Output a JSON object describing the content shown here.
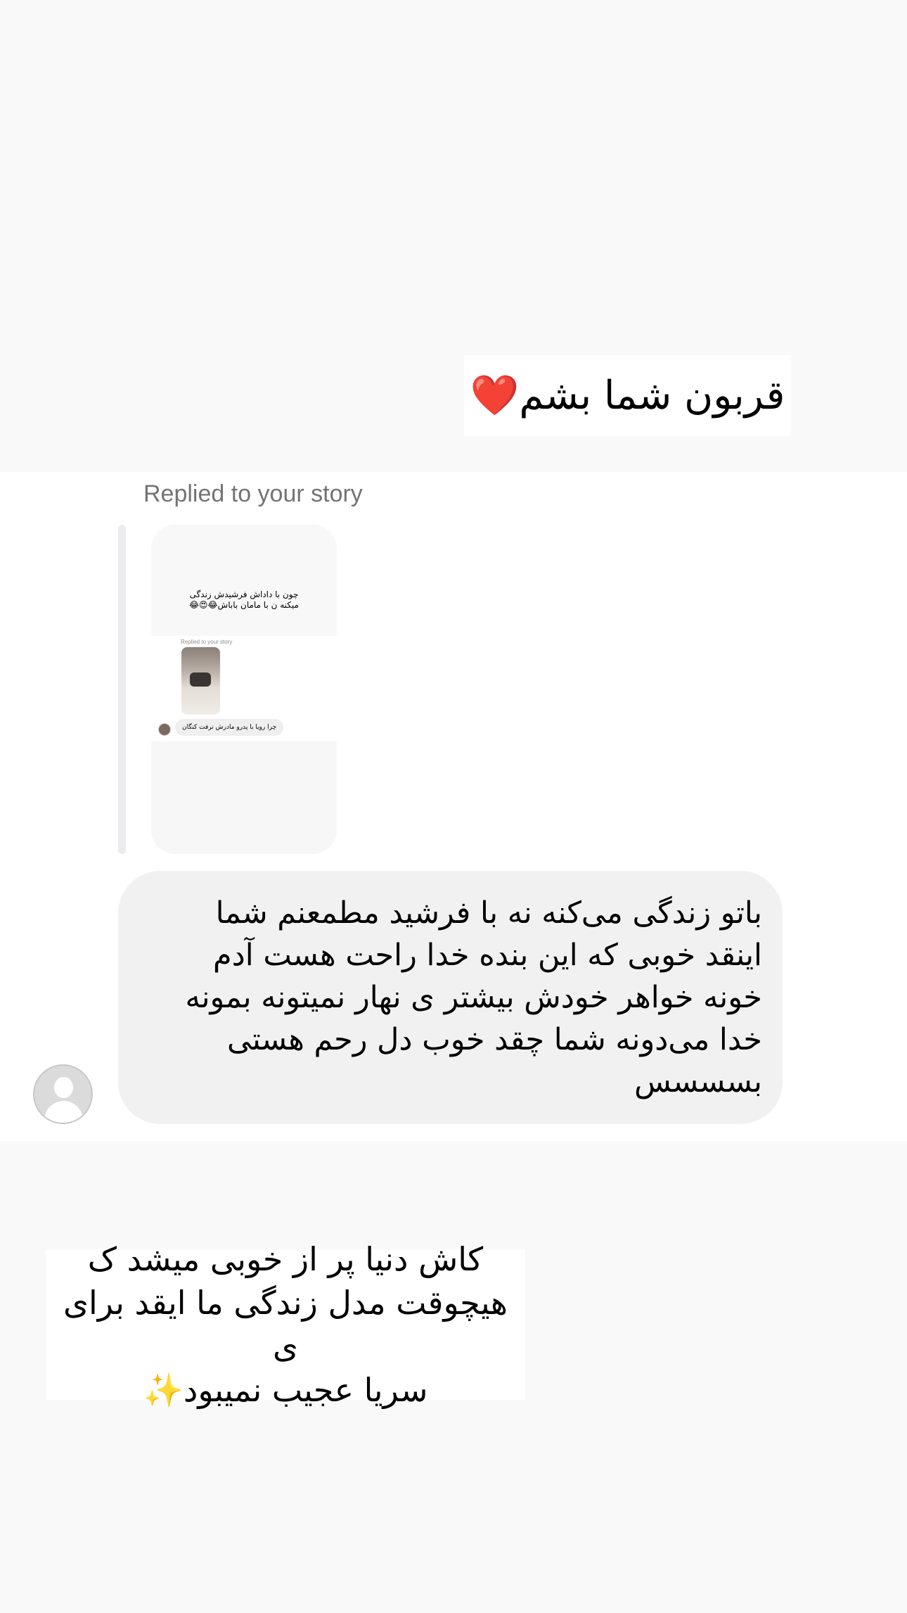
{
  "story_caption_top": "قربون شما بشم❤️",
  "reply_label": "Replied to your story",
  "story_preview": {
    "caption_line1": "چون با داداش فرشیدش زندگی",
    "caption_line2": "میکنه ن با مامان باباش😂😍😂",
    "replied_label": "Replied to your story",
    "bubble_text": "چرا رویا با پدرو مادرش نرفت کنگان"
  },
  "message": {
    "text": "باتو زندگی می‌کنه نه با فرشید مطمعنم شما\nاینقد خوبی که این بنده خدا راحت هست آدم\nخونه خواهر خودش بیشتر ی نهار نمیتونه بمونه\nخدا می‌دونه شما چقد خوب دل رحم هستی\nبسسسس"
  },
  "story_caption_bottom": {
    "line1": "کاش دنیا پر از خوبی میشد ک",
    "line2": "هیچوقت مدل زندگی ما  ایقد برای ی",
    "line3": "سریا عجیب نمیبود✨"
  },
  "colors": {
    "page_bg": "#f9f9fa",
    "bubble_bg": "#f1f1f2",
    "secondary_text": "#737373"
  }
}
